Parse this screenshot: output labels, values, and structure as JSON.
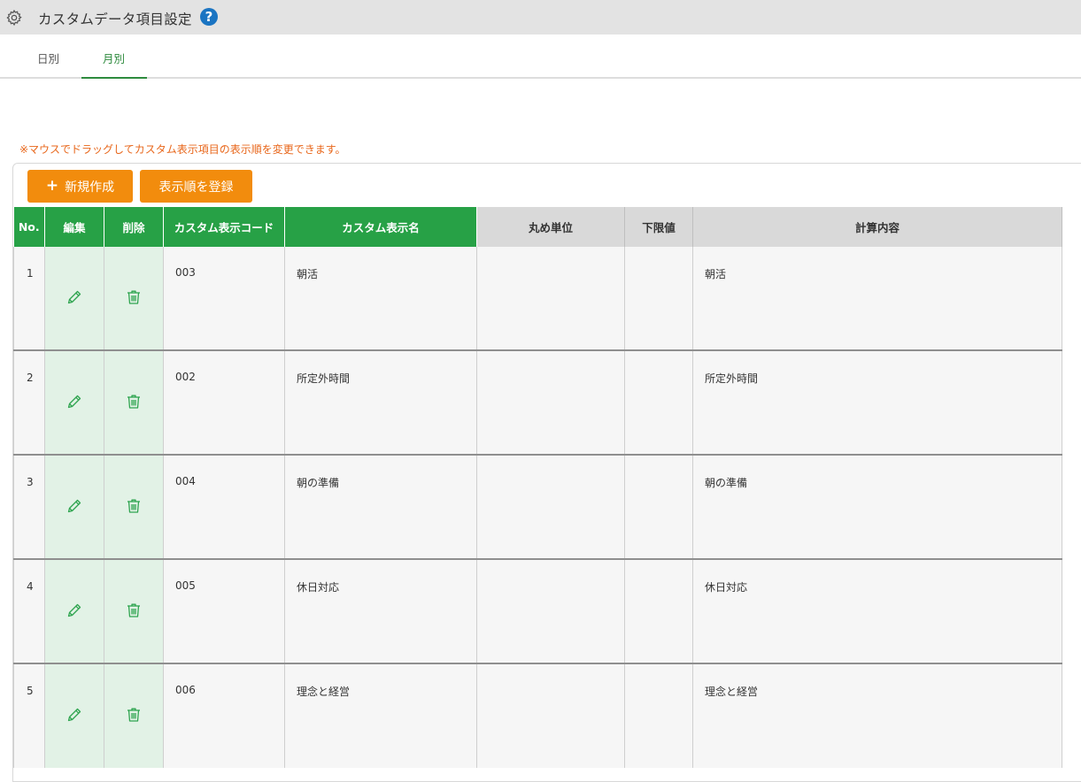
{
  "header": {
    "title": "カスタムデータ項目設定",
    "help_label": "?"
  },
  "tabs": [
    {
      "label": "日別",
      "active": false
    },
    {
      "label": "月別",
      "active": true
    }
  ],
  "notice": "※マウスでドラッグしてカスタム表示項目の表示順を変更できます。",
  "buttons": {
    "new_label": "新規作成",
    "order_label": "表示順を登録"
  },
  "table": {
    "columns": [
      "No.",
      "編集",
      "削除",
      "カスタム表示コード",
      "カスタム表示名",
      "丸め単位",
      "下限値",
      "計算内容"
    ],
    "rows": [
      {
        "no": "1",
        "code": "003",
        "name": "朝活",
        "rounding": "",
        "lower": "",
        "calc": "朝活"
      },
      {
        "no": "2",
        "code": "002",
        "name": "所定外時間",
        "rounding": "",
        "lower": "",
        "calc": "所定外時間"
      },
      {
        "no": "3",
        "code": "004",
        "name": "朝の準備",
        "rounding": "",
        "lower": "",
        "calc": "朝の準備"
      },
      {
        "no": "4",
        "code": "005",
        "name": "休日対応",
        "rounding": "",
        "lower": "",
        "calc": "休日対応"
      },
      {
        "no": "5",
        "code": "006",
        "name": "理念と経営",
        "rounding": "",
        "lower": "",
        "calc": "理念と経営"
      }
    ]
  },
  "icons": {
    "settings": "gear-icon",
    "help": "help-icon",
    "edit": "pencil-icon",
    "delete": "trash-icon",
    "add": "plus-icon"
  },
  "colors": {
    "header_green": "#27a146",
    "action_cell": "#e2f2e6",
    "button_orange": "#f28c0d",
    "notice_orange": "#e8661a",
    "help_blue": "#1a74c2"
  }
}
